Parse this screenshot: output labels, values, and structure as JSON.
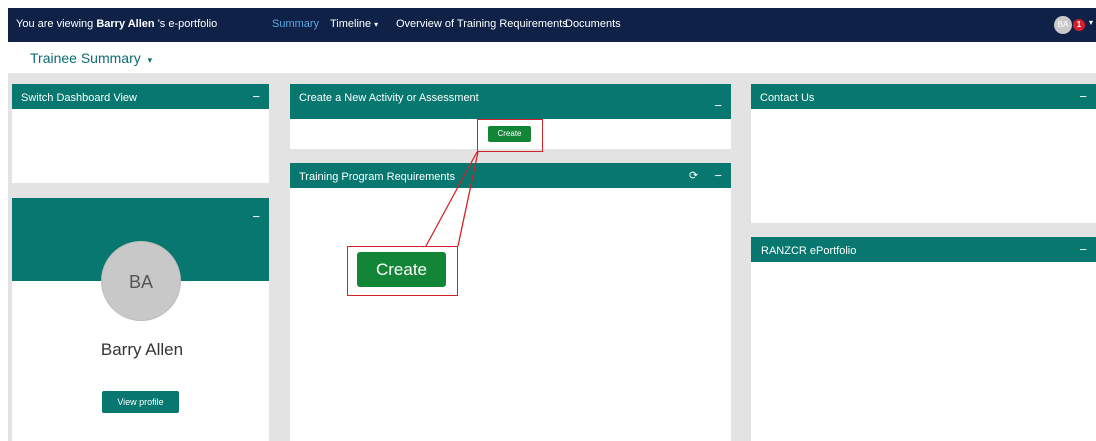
{
  "topbar": {
    "viewing_prefix": "You are viewing",
    "viewing_name": "Barry Allen",
    "viewing_suffix": "'s e-portfolio",
    "nav": [
      {
        "label": "Summary"
      },
      {
        "label": "Timeline",
        "caret": "▾"
      },
      {
        "label": "Overview of Training Requirements"
      },
      {
        "label": "Documents"
      }
    ],
    "user_initials": "BA",
    "notification_count": "1",
    "user_caret": "▾"
  },
  "subheader": {
    "title": "Trainee Summary",
    "caret": "▾"
  },
  "panels": {
    "switch_view": {
      "title": "Switch Dashboard View",
      "minus": "−"
    },
    "profile": {
      "minus": "−",
      "initials": "BA",
      "name": "Barry Allen",
      "view_profile": "View profile"
    },
    "create": {
      "title": "Create a New Activity or Assessment",
      "minus": "−",
      "button": "Create"
    },
    "requirements": {
      "title": "Training Program Requirements",
      "refresh": "⟳",
      "minus": "−",
      "zoom_button": "Create"
    },
    "contact": {
      "title": "Contact Us",
      "minus": "−"
    },
    "ranzcr": {
      "title": "RANZCR ePortfolio",
      "minus": "−"
    }
  },
  "colors": {
    "navbar": "#0f2147",
    "panel_header": "#08776f",
    "create_button": "#138537",
    "annotation": "#d2232a"
  }
}
